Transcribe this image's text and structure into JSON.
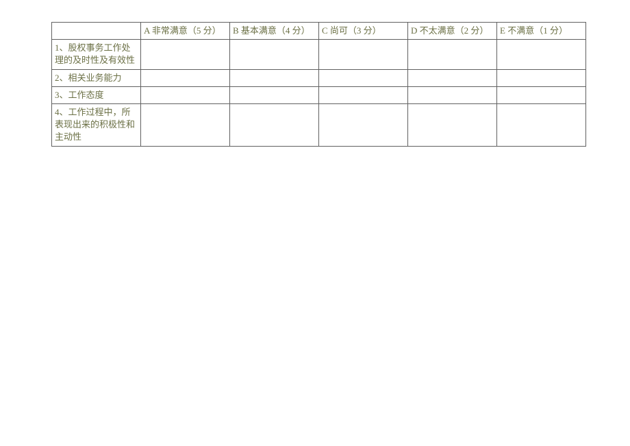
{
  "table": {
    "header": {
      "row_label": "",
      "cols": [
        "A 非常满意（5 分）",
        "B 基本满意（4 分）",
        "C 尚可（3 分）",
        "D 不太满意（2 分）",
        "E 不满意（1 分）"
      ]
    },
    "rows": [
      {
        "label": "1、股权事务工作处理的及时性及有效性",
        "cells": [
          "",
          "",
          "",
          "",
          ""
        ]
      },
      {
        "label": "2、相关业务能力",
        "cells": [
          "",
          "",
          "",
          "",
          ""
        ]
      },
      {
        "label": "3、工作态度",
        "cells": [
          "",
          "",
          "",
          "",
          ""
        ]
      },
      {
        "label": "4、工作过程中，所表现出来的积极性和主动性",
        "cells": [
          "",
          "",
          "",
          "",
          ""
        ]
      }
    ]
  }
}
